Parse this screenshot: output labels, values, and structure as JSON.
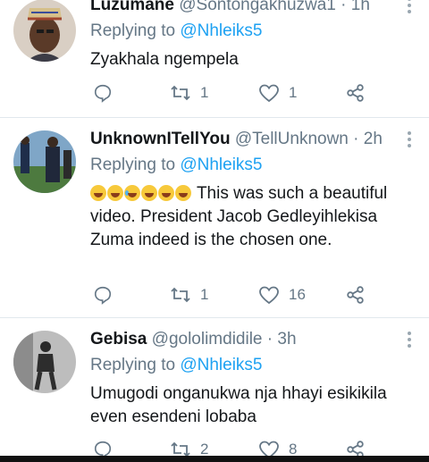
{
  "tweets": [
    {
      "name": "Luzumane",
      "handle": "@Sontongakhuzwa1",
      "time": "· 1h",
      "reply_prefix": "Replying to ",
      "reply_to": "@Nhleiks5",
      "text": "Zyakhala ngempela",
      "replies": "",
      "retweets": "1",
      "likes": "1"
    },
    {
      "name": "UnknownITellYou",
      "handle": "@TellUnknown",
      "time": "· 2h",
      "reply_prefix": "Replying to ",
      "reply_to": "@Nhleiks5",
      "text": "This was such a beautiful video. President Jacob Gedleyihlekisa Zuma indeed is the chosen one.",
      "replies": "",
      "retweets": "1",
      "likes": "16"
    },
    {
      "name": "Gebisa",
      "handle": "@gololimdidile",
      "time": "· 3h",
      "reply_prefix": "Replying to ",
      "reply_to": "@Nhleiks5",
      "text": "Umugodi onganukwa nja hhayi esikikila even esendeni lobaba",
      "replies": "",
      "retweets": "2",
      "likes": "8"
    }
  ],
  "icons": {
    "reply": "reply-icon",
    "retweet": "retweet-icon",
    "like": "heart-icon",
    "share": "share-icon",
    "more": "more-vertical-icon"
  },
  "colors": {
    "link": "#1da1f2",
    "muted": "#657786",
    "text": "#14171a",
    "divider": "#e1e8ed"
  }
}
